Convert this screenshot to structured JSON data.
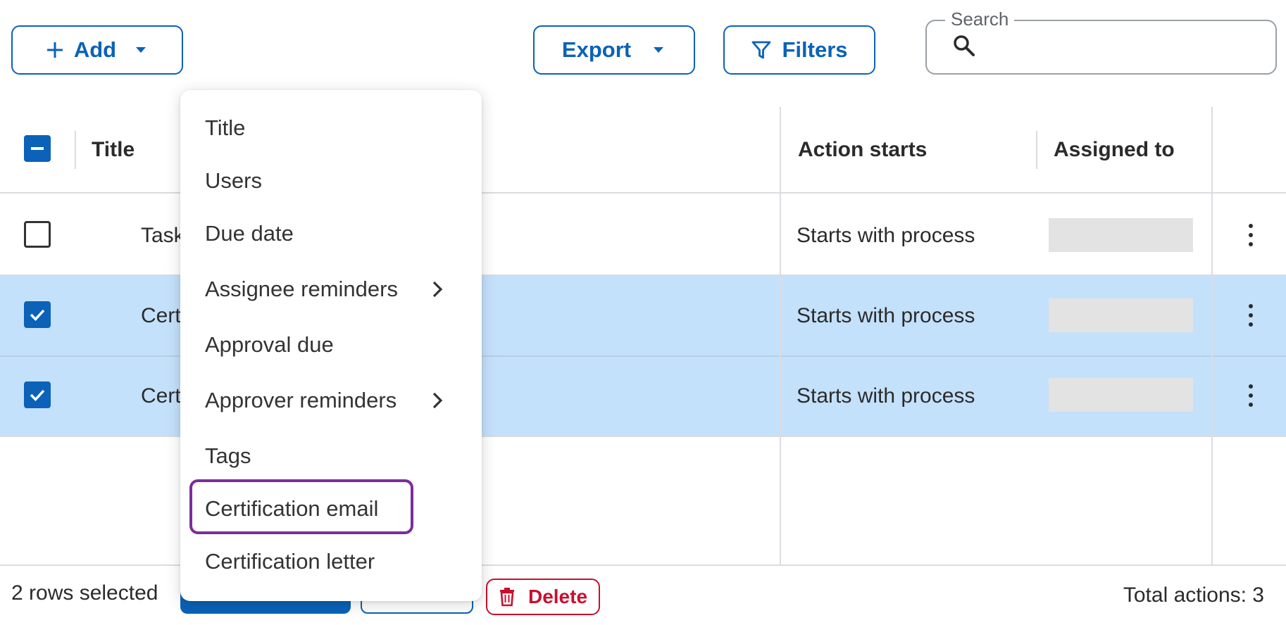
{
  "toolbar": {
    "add_label": "Add",
    "export_label": "Export",
    "filters_label": "Filters",
    "search_label": "Search"
  },
  "table": {
    "columns": [
      "Title",
      "Action starts",
      "Assigned to"
    ],
    "rows": [
      {
        "title": "Task",
        "action_starts": "Starts with process",
        "selected": false
      },
      {
        "title": "Cert",
        "action_starts": "Starts with process",
        "selected": true
      },
      {
        "title": "Cert",
        "action_starts": "Starts with process",
        "selected": true
      }
    ]
  },
  "menu": {
    "items": [
      {
        "label": "Title",
        "has_submenu": false
      },
      {
        "label": "Users",
        "has_submenu": false
      },
      {
        "label": "Due date",
        "has_submenu": false
      },
      {
        "label": "Assignee reminders",
        "has_submenu": true
      },
      {
        "label": "Approval due",
        "has_submenu": false
      },
      {
        "label": "Approver reminders",
        "has_submenu": true
      },
      {
        "label": "Tags",
        "has_submenu": false
      },
      {
        "label": "Certification email",
        "has_submenu": false,
        "highlighted": true
      },
      {
        "label": "Certification letter",
        "has_submenu": false
      }
    ]
  },
  "footer": {
    "rows_selected": "2 rows selected",
    "delete_label": "Delete",
    "total": "Total actions: 3"
  },
  "colors": {
    "primary": "#0b62b8",
    "selected_row": "#c4e1fb",
    "danger": "#c8102e",
    "highlight_outline": "#7b2d9a"
  }
}
